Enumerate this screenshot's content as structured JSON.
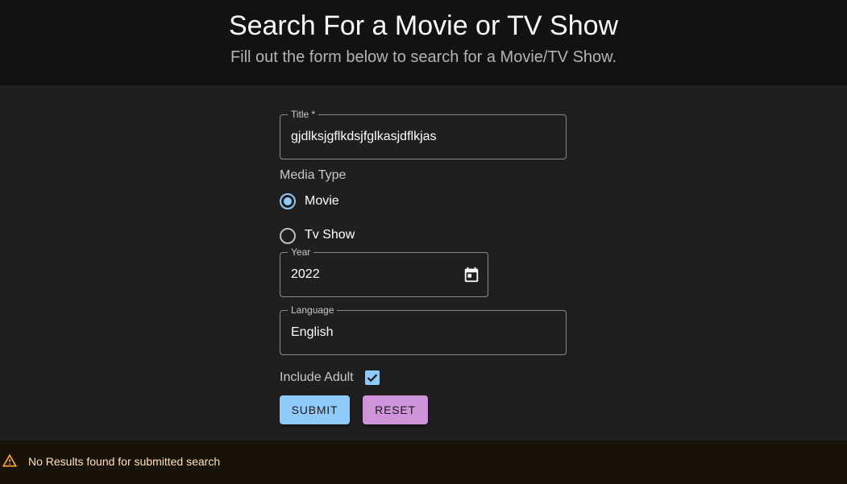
{
  "header": {
    "title": "Search For a Movie or TV Show",
    "subtitle": "Fill out the form below to search for a Movie/TV Show."
  },
  "form": {
    "title_field": {
      "label": "Title *",
      "value": "gjdlksjgflkdsjfglkasjdflkjas"
    },
    "media_type": {
      "label": "Media Type",
      "options": [
        {
          "label": "Movie",
          "selected": true
        },
        {
          "label": "Tv Show",
          "selected": false
        }
      ]
    },
    "year_field": {
      "label": "Year",
      "value": "2022",
      "icon": "calendar-icon"
    },
    "language_field": {
      "label": "Language",
      "value": "English"
    },
    "include_adult": {
      "label": "Include Adult",
      "checked": true
    },
    "submit_label": "SUBMIT",
    "reset_label": "RESET"
  },
  "alert": {
    "message": "No Results found for submitted search",
    "icon": "warning-icon"
  },
  "colors": {
    "primary": "#90caf9",
    "secondary": "#ce93d8",
    "warning": "#ffa726",
    "header_bg": "#121212",
    "body_bg": "#1f1f1f",
    "alert_bg": "#191207",
    "alert_text": "#ffe2b7"
  }
}
